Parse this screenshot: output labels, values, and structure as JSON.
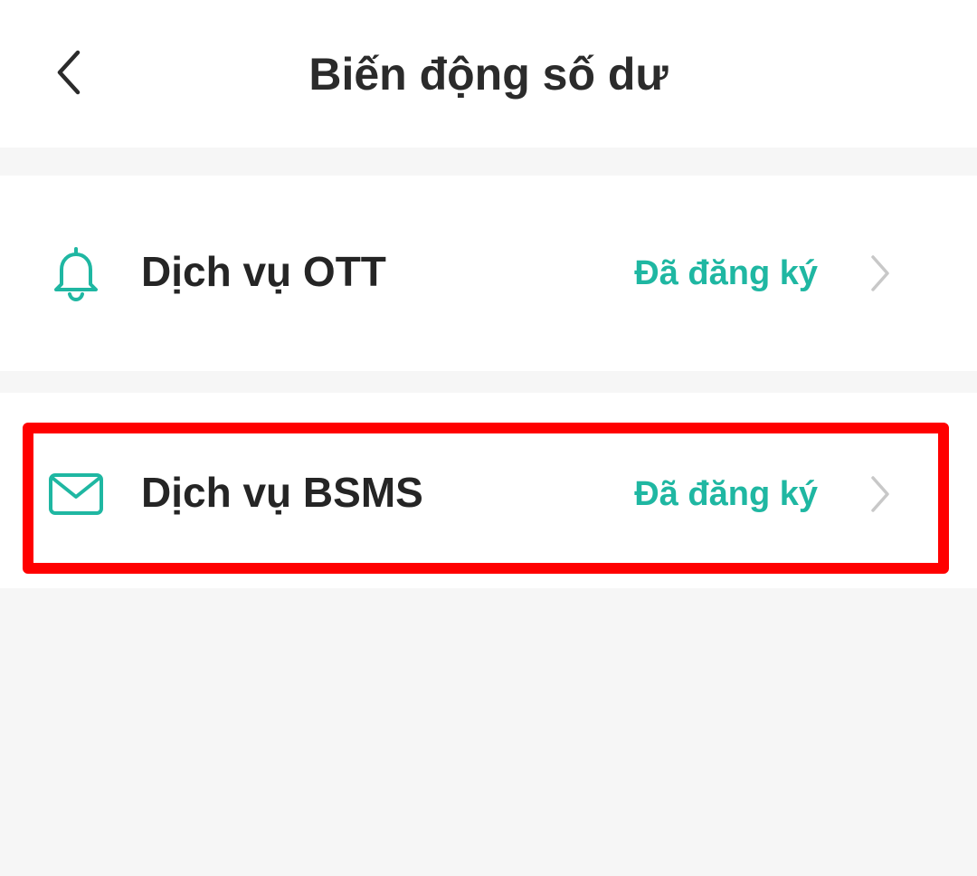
{
  "header": {
    "title": "Biến động số dư",
    "back_icon": "chevron-left-icon"
  },
  "services": [
    {
      "label": "Dịch vụ OTT",
      "status": "Đã đăng ký",
      "icon": "bell-icon"
    },
    {
      "label": "Dịch vụ BSMS",
      "status": "Đã đăng ký",
      "icon": "envelope-icon",
      "highlighted": true
    }
  ],
  "colors": {
    "accent": "#1fb7a2",
    "highlight": "#ff0000",
    "background": "#f6f6f6",
    "text": "#252525"
  }
}
